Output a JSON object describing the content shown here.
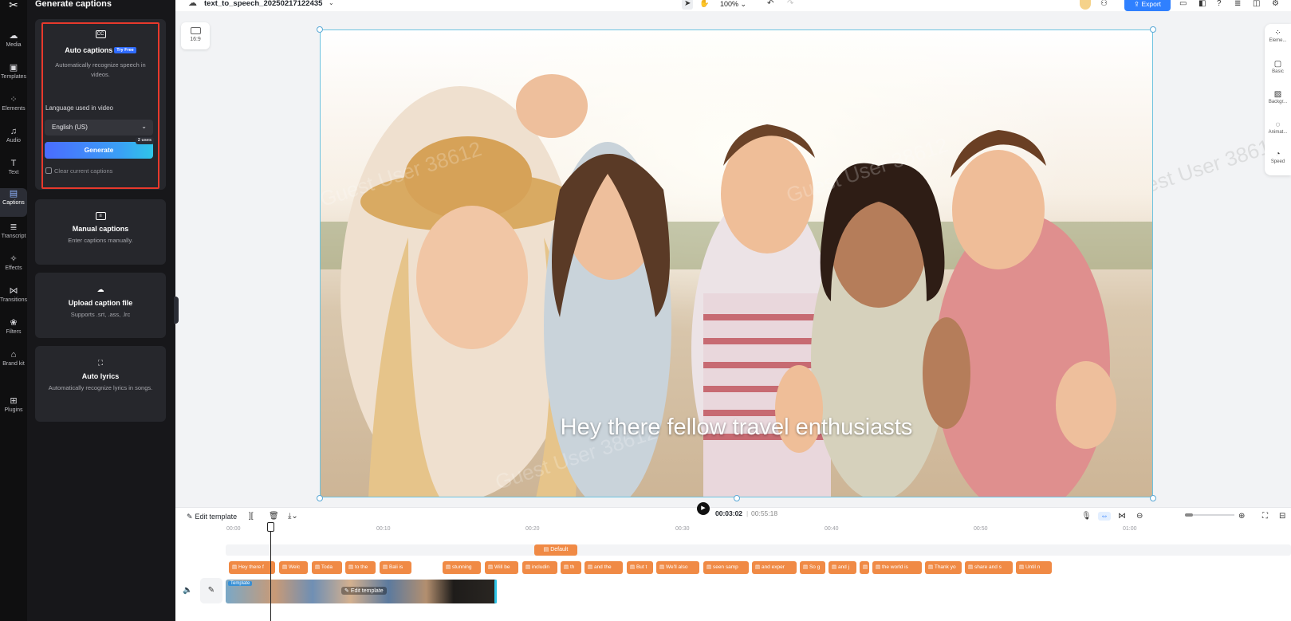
{
  "app": {
    "logo": "✂"
  },
  "rail": {
    "items": [
      {
        "label": "Media",
        "icon": "cloud-icon"
      },
      {
        "label": "Templates",
        "icon": "templates-icon"
      },
      {
        "label": "Elements",
        "icon": "elements-icon"
      },
      {
        "label": "Audio",
        "icon": "music-icon"
      },
      {
        "label": "Text",
        "icon": "text-icon"
      },
      {
        "label": "Captions",
        "icon": "captions-icon"
      },
      {
        "label": "Transcript",
        "icon": "transcript-icon"
      },
      {
        "label": "Effects",
        "icon": "effects-icon"
      },
      {
        "label": "Transitions",
        "icon": "transitions-icon"
      },
      {
        "label": "Filters",
        "icon": "filters-icon"
      },
      {
        "label": "Brand kit",
        "icon": "brand-kit-icon"
      },
      {
        "label": "Plugins",
        "icon": "plugins-icon"
      }
    ]
  },
  "panel": {
    "title": "Generate captions",
    "auto": {
      "title": "Auto captions",
      "badge": "Try Free",
      "desc": "Automatically recognize speech in videos.",
      "language_label": "Language used in video",
      "language_value": "English (US)",
      "generate_label": "Generate",
      "uses_badge": "2 uses",
      "clear_label": "Clear current captions"
    },
    "manual": {
      "title": "Manual captions",
      "desc": "Enter captions manually."
    },
    "upload": {
      "title": "Upload caption file",
      "desc": "Supports .srt, .ass, .lrc"
    },
    "lyrics": {
      "title": "Auto lyrics",
      "desc": "Automatically recognize lyrics in songs."
    }
  },
  "topbar": {
    "project_name": "text_to_speech_20250217122435",
    "zoom": "100%",
    "export_label": "Export"
  },
  "canvas": {
    "ratio_label": "16:9",
    "caption": "Hey there fellow travel enthusiasts",
    "watermark": "Guest User 38612"
  },
  "right_rail": [
    {
      "label": "Eleme...",
      "icon": "elements-icon"
    },
    {
      "label": "Basic",
      "icon": "basic-icon"
    },
    {
      "label": "Backgr...",
      "icon": "background-icon"
    },
    {
      "label": "Animat...",
      "icon": "animation-icon"
    },
    {
      "label": "Speed",
      "icon": "speed-icon"
    }
  ],
  "timeline": {
    "edit_template_label": "Edit template",
    "current_time": "00:03:02",
    "separator": "|",
    "total_time": "00:55:18",
    "ruler": [
      "00:00",
      "00:10",
      "00:20",
      "00:30",
      "00:40",
      "00:50",
      "01:00"
    ],
    "default_track": "Default",
    "captions": [
      "Hey there f",
      "Welc",
      "Toda",
      "to the",
      "Bali is",
      "stunning",
      "Will be",
      "includin",
      "th",
      "and the",
      "But t",
      "We'll also",
      "seen samp",
      "and exper",
      "So g",
      "and j",
      "",
      "the world is",
      "Thank yo",
      "share and s",
      "Until n"
    ],
    "video_label": "Edit template",
    "video_tag": "Template"
  },
  "colors": {
    "accent": "#2f80ff",
    "caption_chip": "#f08a45",
    "highlight": "#e8392c",
    "panel_bg": "#17171a"
  }
}
